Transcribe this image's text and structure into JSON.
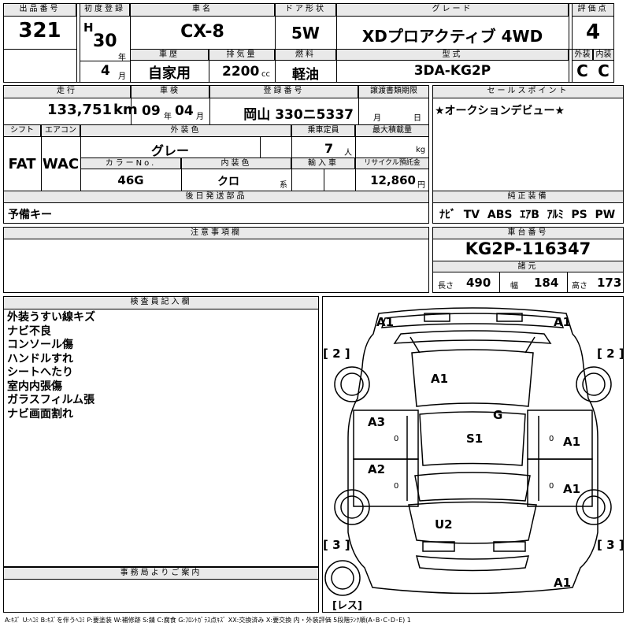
{
  "header": {
    "lot_number_label": "出品番号",
    "lot_number": "321",
    "first_reg_label": "初度登録",
    "era": "H",
    "year": "30",
    "year_unit": "年",
    "month": "4",
    "month_unit": "月",
    "car_name_label": "車名",
    "car_name": "CX-8",
    "door_label": "ドア形状",
    "door": "5W",
    "grade_label": "グレード",
    "grade": "XDプロアクティブ 4WD",
    "score_label": "評価点",
    "score": "4",
    "history_label": "車歴",
    "history": "自家用",
    "displacement_label": "排気量",
    "displacement": "2200",
    "displacement_unit": "cc",
    "fuel_label": "燃料",
    "fuel": "軽油",
    "model_label": "型式",
    "model": "3DA-KG2P",
    "ext_label": "外装",
    "ext": "C",
    "int_label": "内装",
    "int": "C"
  },
  "row2": {
    "mileage_label": "走行",
    "mileage": "133,751",
    "mileage_unit": "km",
    "inspection_label": "車検",
    "insp_year": "09",
    "insp_year_unit": "年",
    "insp_month": "04",
    "insp_month_unit": "月",
    "reg_no_label": "登録番号",
    "reg_no": "岡山 330ニ5337",
    "transfer_label": "譲渡書類期限",
    "transfer_month_unit": "月",
    "transfer_day_unit": "日",
    "sales_point_label": "セールスポイント",
    "sales_point": "★オークションデビュー★"
  },
  "row3": {
    "shift_label": "シフト",
    "shift": "FAT",
    "ac_label": "エアコン",
    "ac": "WAC",
    "ext_color_label": "外装色",
    "ext_color": "グレー",
    "capacity_label": "乗車定員",
    "capacity": "7",
    "capacity_unit": "人",
    "max_load_label": "最大積載量",
    "max_load_unit": "kg",
    "color_no_label": "カラーNo.",
    "color_no": "46G",
    "int_color_label": "内装色",
    "int_color": "クロ",
    "int_color_unit": "系",
    "import_label": "輸入車",
    "recycle_label": "リサイクル預託金",
    "recycle": "12,860",
    "recycle_unit": "円"
  },
  "parts": {
    "label": "後日発送部品",
    "value": "予備キー"
  },
  "equipment": {
    "label": "純正装備",
    "value": "ﾅﾋﾞ  TV  ABS  ｴｱB  ｱﾙﾐ  PS  PW"
  },
  "notes_label": "注意事項欄",
  "chassis": {
    "label": "車台番号",
    "value": "KG2P-116347",
    "spec_label": "諸元",
    "length_label": "長さ",
    "length": "490",
    "width_label": "幅",
    "width": "184",
    "height_label": "高さ",
    "height": "173"
  },
  "inspector": {
    "label": "検査員記入欄",
    "lines": [
      "外装うすい線キズ",
      "ナビ不良",
      "コンソール傷",
      "ハンドルすれ",
      "シートへたり",
      "室内内張傷",
      "ガラスフィルム張",
      "ナビ画面割れ"
    ]
  },
  "office_label": "事務局よりご案内",
  "diagram": {
    "marks": [
      "A1",
      "A1",
      "A1",
      "G",
      "A3",
      "S1",
      "A1",
      "A2",
      "A1",
      "U2",
      "A1"
    ],
    "bracket_2": "[ 2 ]",
    "bracket_3": "[ 3 ]",
    "zero": "0",
    "spare": "[レス]"
  },
  "legend": "A:ｷｽﾞ U:ﾍｺﾐ B:ｷｽﾞを伴うﾍｺﾐ P:要塗装 W:補修跡 S:錆 C:腐食 G:ﾌﾛﾝﾄｶﾞﾗｽ点ｷｽﾞ XX:交換済み X:要交換 内・外装評価 5段階ﾗﾝｸ順(A･B･C･D･E) 1"
}
